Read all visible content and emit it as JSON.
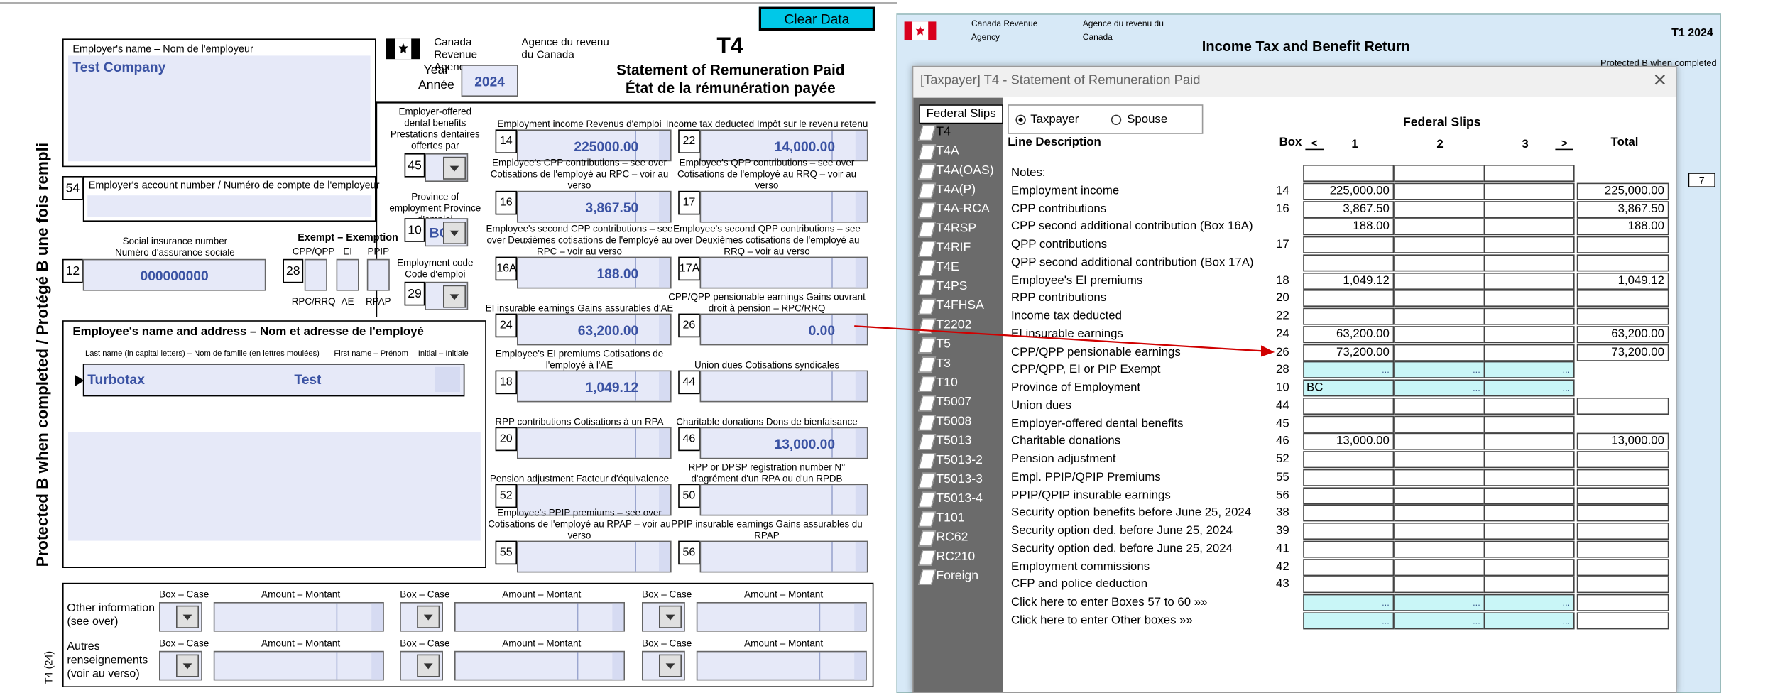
{
  "toolbar": {
    "clear_label": "Clear Data"
  },
  "form": {
    "cra_en": "Canada Revenue Agency",
    "cra_fr": "Agence du revenu du Canada",
    "title_code": "T4",
    "title_en": "Statement of Remuneration Paid",
    "title_fr": "État de la rémunération payée",
    "year_label": "Year Année",
    "year": "2024",
    "employer_name_label": "Employer's name – Nom de l'employeur",
    "employer_name": "Test Company",
    "acct_label": "Employer's account number / Numéro de compte de l'employeur",
    "acct_box": "54",
    "sin_label": "Social insurance number Numéro d'assurance sociale",
    "sin_box": "12",
    "sin": "000000000",
    "exempt_label": "Exempt – Exemption",
    "exempt_cols": [
      "CPP/QPP",
      "EI",
      "PPIP"
    ],
    "exempt_box": "28",
    "exempt_fr": [
      "RPC/RRQ",
      "AE",
      "RPAP"
    ],
    "dental_label": "Employer-offered dental benefits Prestations dentaires offertes par l'employeur",
    "dental_box": "45",
    "province_label": "Province of employment Province d'emploi",
    "province_box": "10",
    "province": "BC",
    "empcode_label": "Employment code Code d'emploi",
    "empcode_box": "29",
    "employee_label": "Employee's name and address – Nom et adresse de l'employé",
    "last_name_label": "Last name (in capital letters) – Nom de famille (en lettres moulées)",
    "first_name_label": "First name – Prénom",
    "initial_label": "Initial – Initiale",
    "last_name": "Turbotax",
    "first_name": "Test",
    "side_text": "Protected B when completed / Protégé B une fois rempli",
    "side_small": "T4 (24)",
    "boxes": [
      {
        "no": "14",
        "label": "Employment income Revenus d'emploi",
        "value": "225000.00"
      },
      {
        "no": "22",
        "label": "Income tax deducted Impôt sur le revenu retenu",
        "value": "14,000.00"
      },
      {
        "no": "16",
        "label": "Employee's CPP contributions – see over Cotisations de l'employé au RPC – voir au verso",
        "value": "3,867.50"
      },
      {
        "no": "17",
        "label": "Employee's QPP contributions – see over Cotisations de l'employé au RRQ – voir au verso",
        "value": ""
      },
      {
        "no": "16A",
        "label": "Employee's second CPP contributions – see over Deuxièmes cotisations de l'employé au RPC – voir au verso",
        "value": "188.00"
      },
      {
        "no": "17A",
        "label": "Employee's second QPP contributions – see over Deuxièmes cotisations de l'employé au RRQ – voir au verso",
        "value": ""
      },
      {
        "no": "24",
        "label": "EI insurable earnings Gains assurables d'AE",
        "value": "63,200.00"
      },
      {
        "no": "26",
        "label": "CPP/QPP pensionable earnings Gains ouvrant droit à pension – RPC/RRQ",
        "value": "0.00"
      },
      {
        "no": "18",
        "label": "Employee's EI premiums Cotisations de l'employé à l'AE",
        "value": "1,049.12"
      },
      {
        "no": "44",
        "label": "Union dues Cotisations syndicales",
        "value": ""
      },
      {
        "no": "20",
        "label": "RPP contributions Cotisations à un RPA",
        "value": ""
      },
      {
        "no": "46",
        "label": "Charitable donations Dons de bienfaisance",
        "value": "13,000.00"
      },
      {
        "no": "52",
        "label": "Pension adjustment Facteur d'équivalence",
        "value": ""
      },
      {
        "no": "50",
        "label": "RPP or DPSP registration number N° d'agrément d'un RPA ou d'un RPDB",
        "value": ""
      },
      {
        "no": "55",
        "label": "Employee's PPIP premiums – see over Cotisations de l'employé au RPAP – voir au verso",
        "value": ""
      },
      {
        "no": "56",
        "label": "PPIP insurable earnings Gains assurables du RPAP",
        "value": ""
      }
    ],
    "other_info_en": "Other information (see over)",
    "other_info_fr": "Autres renseignements (voir au verso)",
    "box_case": "Box – Case",
    "amount": "Amount – Montant"
  },
  "background": {
    "cra_en": "Canada Revenue Agency",
    "cra_fr": "Agence du revenu du Canada",
    "title": "Income Tax and Benefit Return",
    "form_code": "T1 2024",
    "protected": "Protected B when completed",
    "page_no": "7"
  },
  "dialog": {
    "title": "[Taxpayer] T4  - Statement of Remuneration Paid",
    "close": "×",
    "federal_slips_btn": "Federal Slips",
    "radio_taxpayer": "Taxpayer",
    "radio_spouse": "Spouse",
    "header_title": "Federal Slips",
    "col_desc": "Line Description",
    "col_box": "Box",
    "nav_prev": "<",
    "nav_next": ">",
    "cols": [
      "1",
      "2",
      "3"
    ],
    "col_total": "Total",
    "slips": [
      "T4",
      "T4A",
      "T4A(OAS)",
      "T4A(P)",
      "T4A-RCA",
      "T4RSP",
      "T4RIF",
      "T4E",
      "T4PS",
      "T4FHSA",
      "T2202",
      "T5",
      "T3",
      "T10",
      "T5007",
      "T5008",
      "T5013",
      "T5013-2",
      "T5013-3",
      "T5013-4",
      "T101",
      "RC62",
      "RC210",
      "Foreign"
    ],
    "rows": [
      {
        "desc": "Notes:",
        "box": "",
        "v1": "",
        "v2": "",
        "v3": "",
        "total": "",
        "cyan": false,
        "nototal": true
      },
      {
        "desc": "Employment income",
        "box": "14",
        "v1": "225,000.00",
        "v2": "",
        "v3": "",
        "total": "225,000.00",
        "cyan": false
      },
      {
        "desc": "CPP contributions",
        "box": "16",
        "v1": "3,867.50",
        "v2": "",
        "v3": "",
        "total": "3,867.50",
        "cyan": false
      },
      {
        "desc": "CPP second additional contribution (Box 16A)",
        "box": "",
        "v1": "188.00",
        "v2": "",
        "v3": "",
        "total": "188.00",
        "cyan": false
      },
      {
        "desc": "QPP contributions",
        "box": "17",
        "v1": "",
        "v2": "",
        "v3": "",
        "total": "",
        "cyan": false
      },
      {
        "desc": "QPP second additional contribution (Box 17A)",
        "box": "",
        "v1": "",
        "v2": "",
        "v3": "",
        "total": "",
        "cyan": false
      },
      {
        "desc": "Employee's EI premiums",
        "box": "18",
        "v1": "1,049.12",
        "v2": "",
        "v3": "",
        "total": "1,049.12",
        "cyan": false
      },
      {
        "desc": "RPP contributions",
        "box": "20",
        "v1": "",
        "v2": "",
        "v3": "",
        "total": "",
        "cyan": false
      },
      {
        "desc": "Income tax deducted",
        "box": "22",
        "v1": "",
        "v2": "",
        "v3": "",
        "total": "",
        "cyan": false
      },
      {
        "desc": "EI insurable earnings",
        "box": "24",
        "v1": "63,200.00",
        "v2": "",
        "v3": "",
        "total": "63,200.00",
        "cyan": false
      },
      {
        "desc": "CPP/QPP pensionable earnings",
        "box": "26",
        "v1": "73,200.00",
        "v2": "",
        "v3": "",
        "total": "73,200.00",
        "cyan": false
      },
      {
        "desc": "CPP/QPP, EI or PIP Exempt",
        "box": "28",
        "v1": "...",
        "v2": "...",
        "v3": "...",
        "total": "",
        "cyan": true,
        "nototal": true
      },
      {
        "desc": "Province of Employment",
        "box": "10",
        "v1": "BC",
        "v2": "...",
        "v3": "...",
        "total": "",
        "cyan": true,
        "nototal": true
      },
      {
        "desc": "Union dues",
        "box": "44",
        "v1": "",
        "v2": "",
        "v3": "",
        "total": "",
        "cyan": false
      },
      {
        "desc": "Employer-offered dental benefits",
        "box": "45",
        "v1": "",
        "v2": "",
        "v3": "",
        "total": "",
        "cyan": false,
        "nototal": true
      },
      {
        "desc": "Charitable donations",
        "box": "46",
        "v1": "13,000.00",
        "v2": "",
        "v3": "",
        "total": "13,000.00",
        "cyan": false
      },
      {
        "desc": "Pension adjustment",
        "box": "52",
        "v1": "",
        "v2": "",
        "v3": "",
        "total": "",
        "cyan": false
      },
      {
        "desc": "Empl. PPIP/QPIP Premiums",
        "box": "55",
        "v1": "",
        "v2": "",
        "v3": "",
        "total": "",
        "cyan": false
      },
      {
        "desc": "PPIP/QPIP insurable earnings",
        "box": "56",
        "v1": "",
        "v2": "",
        "v3": "",
        "total": "",
        "cyan": false
      },
      {
        "desc": "Security option benefits before June 25, 2024",
        "box": "38",
        "v1": "",
        "v2": "",
        "v3": "",
        "total": "",
        "cyan": false
      },
      {
        "desc": "Security option ded. before June 25, 2024",
        "box": "39",
        "v1": "",
        "v2": "",
        "v3": "",
        "total": "",
        "cyan": false
      },
      {
        "desc": "Security option ded. before June 25, 2024",
        "box": "41",
        "v1": "",
        "v2": "",
        "v3": "",
        "total": "",
        "cyan": false
      },
      {
        "desc": "Employment commissions",
        "box": "42",
        "v1": "",
        "v2": "",
        "v3": "",
        "total": "",
        "cyan": false
      },
      {
        "desc": "CFP and police deduction",
        "box": "43",
        "v1": "",
        "v2": "",
        "v3": "",
        "total": "",
        "cyan": false
      },
      {
        "desc": "Click here to enter Boxes 57 to 60 »»",
        "box": "",
        "v1": "...",
        "v2": "...",
        "v3": "...",
        "total": "",
        "cyan": true
      },
      {
        "desc": "Click here to enter Other boxes »»",
        "box": "",
        "v1": "...",
        "v2": "...",
        "v3": "...",
        "total": "",
        "cyan": true
      }
    ]
  },
  "colors": {
    "accent_cyan": "#00c8e8",
    "field_bg": "#e6e9f8",
    "field_text": "#3a52a3",
    "arrow": "#d00000",
    "sidebar": "#6b6b6b"
  }
}
